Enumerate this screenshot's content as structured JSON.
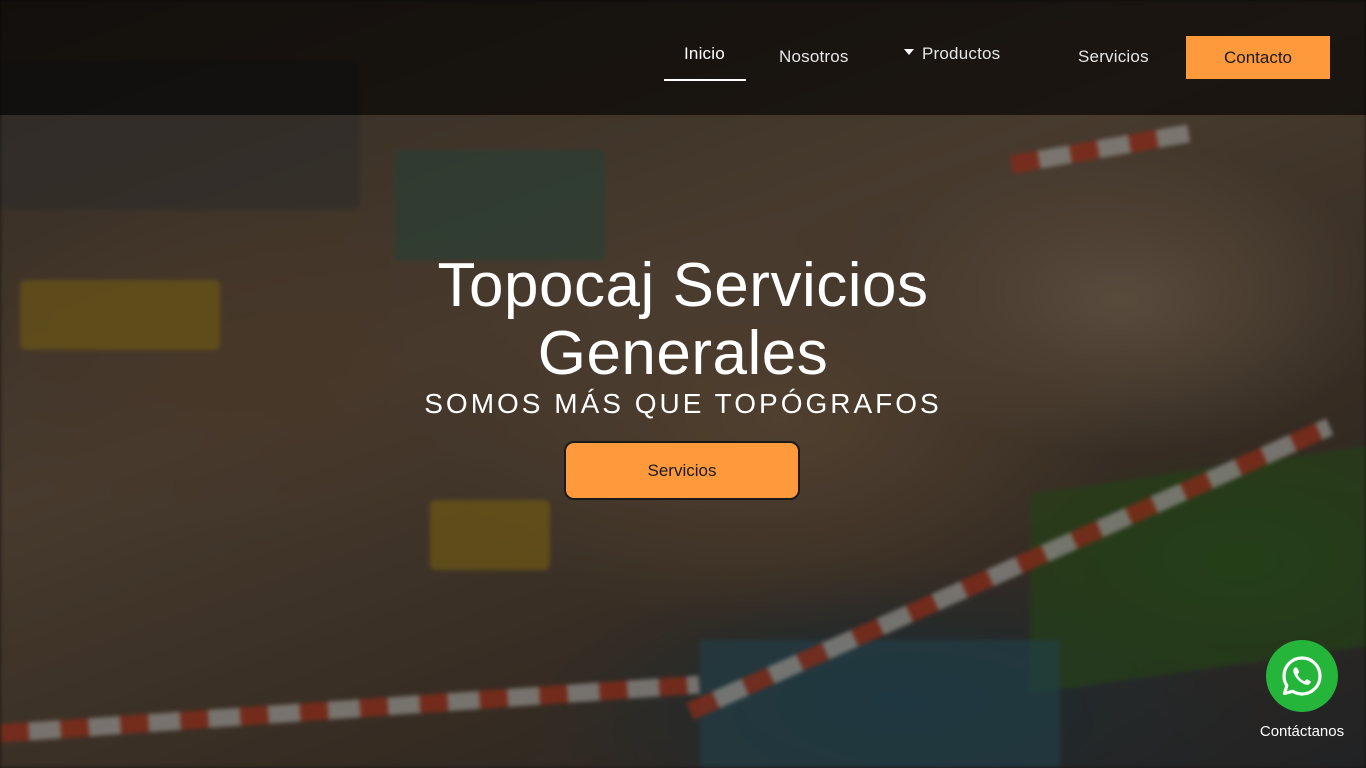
{
  "nav": {
    "items": [
      {
        "label": "Inicio",
        "active": true
      },
      {
        "label": "Nosotros"
      },
      {
        "label": "Productos",
        "has_dropdown": true
      },
      {
        "label": "Servicios"
      }
    ],
    "contact_label": "Contacto"
  },
  "hero": {
    "title_line1": "Topocaj Servicios",
    "title_line2": "Generales",
    "subtitle": "SOMOS MÁS QUE TOPÓGRAFOS",
    "cta_label": "Servicios"
  },
  "whatsapp": {
    "icon": "whatsapp-icon",
    "label": "Contáctanos"
  },
  "colors": {
    "accent": "#ff9a3c",
    "whatsapp": "#25b53a",
    "nav_bg": "rgba(0,0,0,0.62)"
  }
}
